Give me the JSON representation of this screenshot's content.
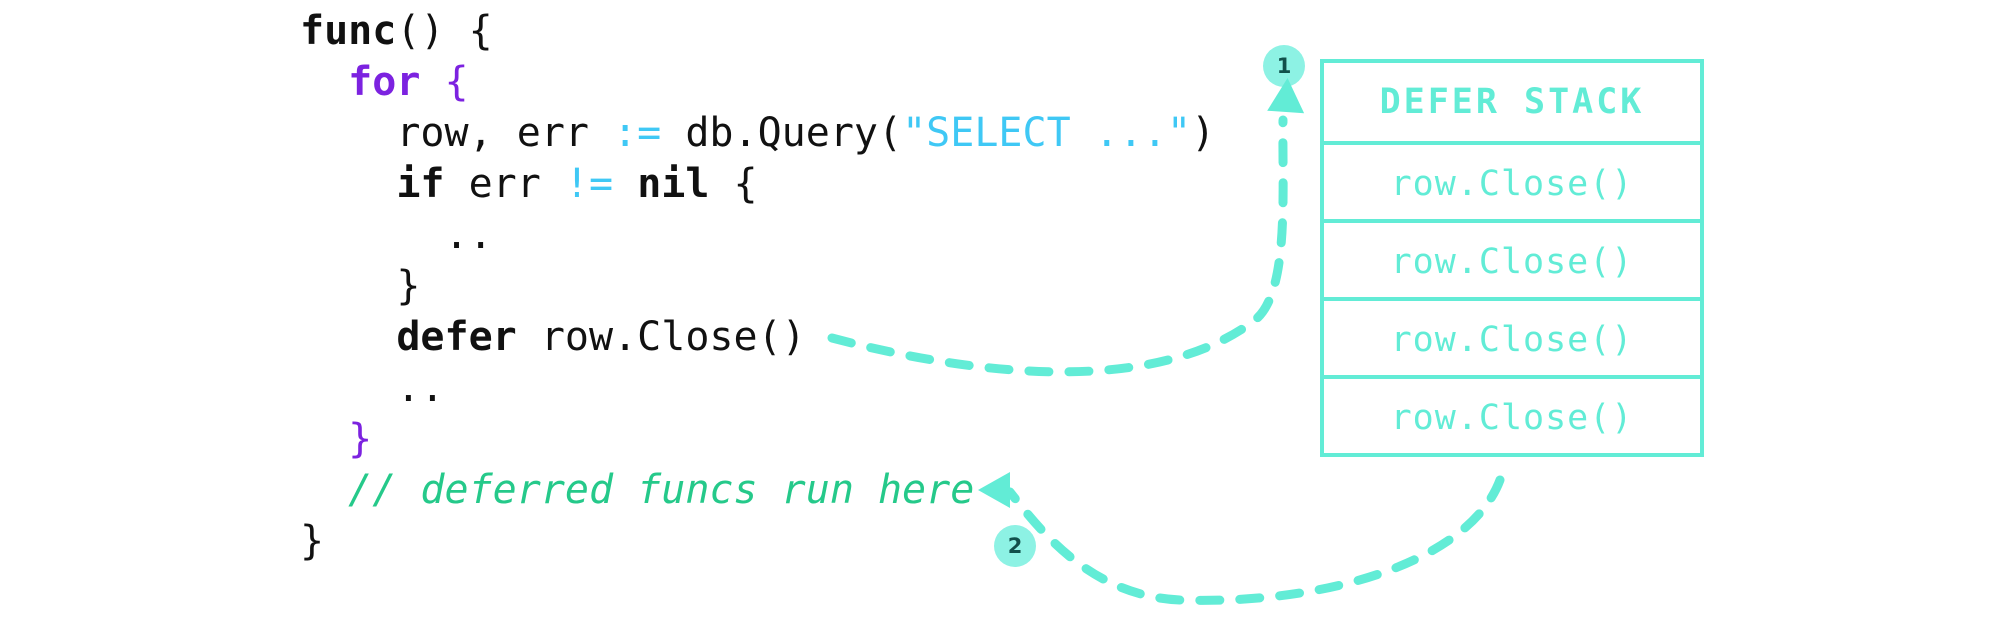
{
  "theme": {
    "background": "#ffffff",
    "accent_teal": "#62ECD6",
    "marker_fill": "#8DF2E4",
    "marker_text": "#11504B",
    "keyword_purple": "#7C22E0",
    "string_blue": "#3FC8F5",
    "comment_green": "#25C98A",
    "code_black": "#111111"
  },
  "code": {
    "language": "go",
    "lines": [
      {
        "id": "line-func",
        "tokens": [
          {
            "text": "func",
            "style": "bold"
          },
          {
            "text": "() {",
            "style": "plain"
          }
        ]
      },
      {
        "id": "line-for",
        "tokens": [
          {
            "text": "  ",
            "style": "plain"
          },
          {
            "text": "for",
            "style": "kw"
          },
          {
            "text": " ",
            "style": "plain"
          },
          {
            "text": "{",
            "style": "brace-kw"
          }
        ]
      },
      {
        "id": "line-query",
        "tokens": [
          {
            "text": "    row, err ",
            "style": "plain"
          },
          {
            "text": ":=",
            "style": "op"
          },
          {
            "text": " db.Query(",
            "style": "plain"
          },
          {
            "text": "\"SELECT ...\"",
            "style": "str"
          },
          {
            "text": ")",
            "style": "plain"
          }
        ]
      },
      {
        "id": "line-if",
        "tokens": [
          {
            "text": "    ",
            "style": "plain"
          },
          {
            "text": "if",
            "style": "bold"
          },
          {
            "text": " err ",
            "style": "plain"
          },
          {
            "text": "!=",
            "style": "op"
          },
          {
            "text": " ",
            "style": "plain"
          },
          {
            "text": "nil",
            "style": "bold"
          },
          {
            "text": " {",
            "style": "plain"
          }
        ]
      },
      {
        "id": "line-dots-1",
        "tokens": [
          {
            "text": "      ..",
            "style": "plain"
          }
        ]
      },
      {
        "id": "line-close-if",
        "tokens": [
          {
            "text": "    }",
            "style": "plain"
          }
        ]
      },
      {
        "id": "line-defer",
        "tokens": [
          {
            "text": "    ",
            "style": "plain"
          },
          {
            "text": "defer",
            "style": "bold"
          },
          {
            "text": " row.Close()",
            "style": "plain"
          }
        ]
      },
      {
        "id": "line-dots-2",
        "tokens": [
          {
            "text": "    ..",
            "style": "plain"
          }
        ]
      },
      {
        "id": "line-close-for",
        "tokens": [
          {
            "text": "  ",
            "style": "plain"
          },
          {
            "text": "}",
            "style": "brace-kw"
          }
        ]
      },
      {
        "id": "line-comment",
        "tokens": [
          {
            "text": "  ",
            "style": "plain"
          },
          {
            "text": "// deferred funcs run here",
            "style": "comment"
          }
        ]
      },
      {
        "id": "line-close-func",
        "tokens": [
          {
            "text": "}",
            "style": "plain"
          }
        ]
      }
    ]
  },
  "defer_stack": {
    "title": "DEFER STACK",
    "entries": [
      "row.Close()",
      "row.Close()",
      "row.Close()",
      "row.Close()"
    ]
  },
  "markers": [
    {
      "id": "marker-1",
      "label": "1"
    },
    {
      "id": "marker-2",
      "label": "2"
    }
  ]
}
